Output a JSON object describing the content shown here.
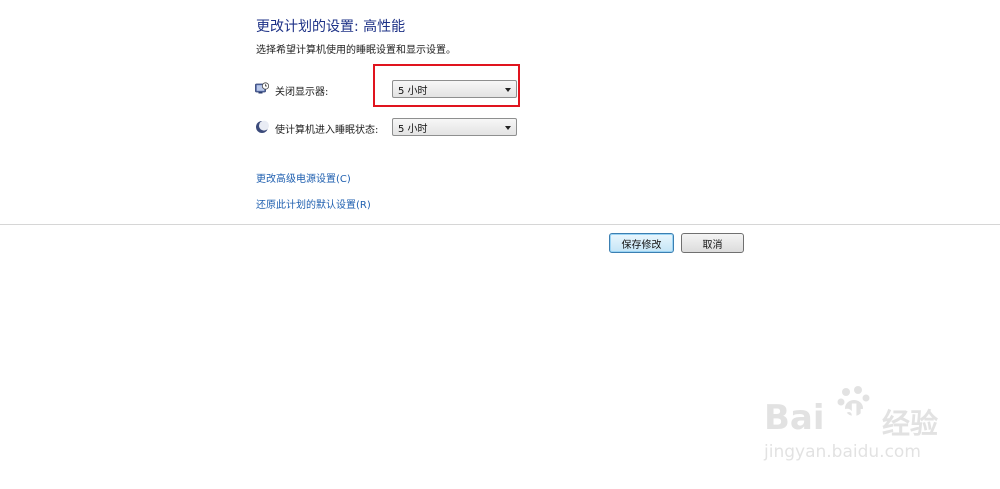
{
  "header": {
    "title": "更改计划的设置: 高性能",
    "subtitle": "选择希望计算机使用的睡眠设置和显示设置。"
  },
  "settings": {
    "display_off": {
      "label": "关闭显示器:",
      "value": "5 小时",
      "icon": "monitor-icon"
    },
    "sleep": {
      "label": "使计算机进入睡眠状态:",
      "value": "5 小时",
      "icon": "moon-icon"
    }
  },
  "links": {
    "advanced": "更改高级电源设置(C)",
    "restore": "还原此计划的默认设置(R)"
  },
  "buttons": {
    "save": "保存修改",
    "cancel": "取消"
  },
  "watermark": {
    "brand": "Bai",
    "brand2": "du",
    "suffix": "经验",
    "url": "jingyan.baidu.com"
  },
  "colors": {
    "highlight": "#e0141e",
    "title": "#1e3287",
    "link": "#2060b0"
  }
}
